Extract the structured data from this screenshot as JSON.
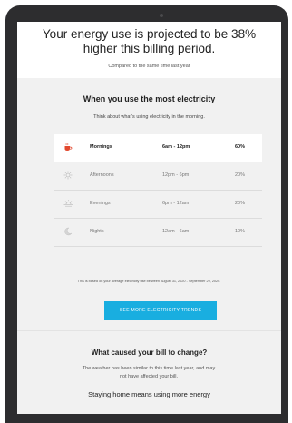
{
  "header": {
    "headline": "Your energy use is projected to be 38% higher this billing period.",
    "subline": "Compared to the same time last year"
  },
  "usage": {
    "title": "When you use the most electricity",
    "subtitle": "Think about what's using electricity in the morning.",
    "rows": [
      {
        "icon": "coffee-cup-icon",
        "period": "Mornings",
        "hours": "6am - 12pm",
        "percent": "60%"
      },
      {
        "icon": "sun-icon",
        "period": "Afternoons",
        "hours": "12pm - 6pm",
        "percent": "20%"
      },
      {
        "icon": "sunset-icon",
        "period": "Evenings",
        "hours": "6pm - 12am",
        "percent": "20%"
      },
      {
        "icon": "moon-icon",
        "period": "Nights",
        "hours": "12am - 6am",
        "percent": "10%"
      }
    ],
    "footnote": "This is based on your average electricity use between August 31, 2020 - September 29, 2020.",
    "cta_label": "SEE MORE ELECTRICITY TRENDS"
  },
  "cause": {
    "title": "What caused your bill to change?",
    "text": "The weather has been similar to this time last year, and may not have affected your bill.",
    "footer": "Staying home means using more energy"
  },
  "colors": {
    "accent": "#19aee0",
    "coffee": "#e2492f",
    "icon_gray": "#bdbdbd"
  }
}
